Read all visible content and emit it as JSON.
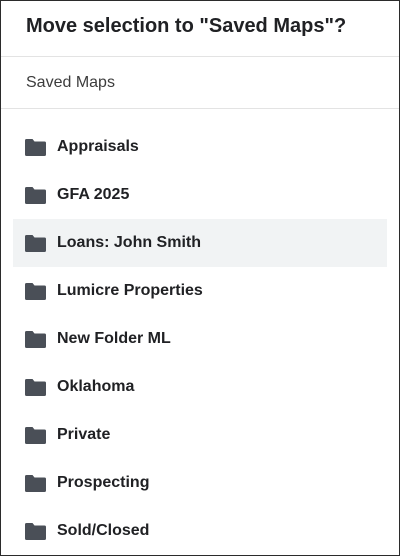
{
  "dialog": {
    "title": "Move selection to \"Saved Maps\"?",
    "breadcrumb": "Saved Maps",
    "folder_icon": "folder-icon",
    "folder_color": "#4a4f57",
    "selected_bg": "#f1f3f4"
  },
  "folders": [
    {
      "label": "Appraisals"
    },
    {
      "label": "GFA 2025"
    },
    {
      "label": "Loans: John Smith"
    },
    {
      "label": "Lumicre Properties"
    },
    {
      "label": "New Folder ML"
    },
    {
      "label": "Oklahoma"
    },
    {
      "label": "Private"
    },
    {
      "label": "Prospecting"
    },
    {
      "label": "Sold/Closed"
    }
  ],
  "selected_folder": "Loans: John Smith"
}
